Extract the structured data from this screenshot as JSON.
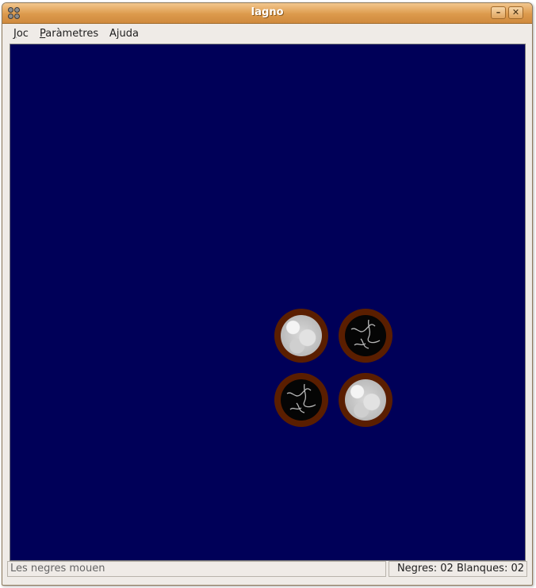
{
  "window": {
    "title": "Iagno",
    "minimize_symbol": "–",
    "close_symbol": "✕",
    "titlebar_color": "#dc9a4c"
  },
  "menu": [
    {
      "label": "Joc",
      "mnemonic_index": 0
    },
    {
      "label": "Paràmetres",
      "mnemonic_index": 0
    },
    {
      "label": "Ajuda",
      "mnemonic_index": 1
    }
  ],
  "board": {
    "background_color": "#000058",
    "size": 8,
    "pieces": [
      {
        "row": 4,
        "col": 4,
        "color": "white"
      },
      {
        "row": 4,
        "col": 5,
        "color": "black"
      },
      {
        "row": 5,
        "col": 4,
        "color": "black"
      },
      {
        "row": 5,
        "col": 5,
        "color": "white"
      }
    ]
  },
  "status": {
    "message": "Les negres mouen",
    "score": "Negres: 02 Blanques: 02"
  }
}
